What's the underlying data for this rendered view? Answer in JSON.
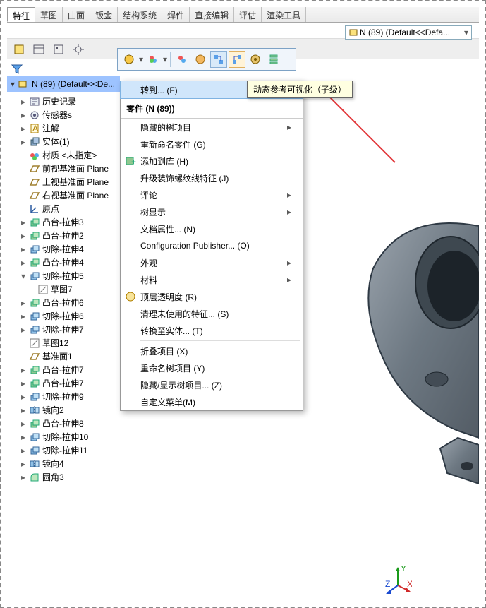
{
  "maintabs": [
    "特征",
    "草图",
    "曲面",
    "钣金",
    "结构系统",
    "焊件",
    "直接编辑",
    "评估",
    "渲染工具"
  ],
  "maintabs_active": 0,
  "config_selector": {
    "label": "N (89)  (Default<<Defa..."
  },
  "tooltip": "动态参考可视化（子级）",
  "tree": {
    "head": "N (89)  (Default<<De...",
    "items": [
      {
        "label": "历史记录",
        "icon": "history",
        "ind": 1,
        "tw": "▸"
      },
      {
        "label": "传感器s",
        "icon": "sensor",
        "ind": 1,
        "tw": "▸"
      },
      {
        "label": "注解",
        "icon": "note",
        "ind": 1,
        "tw": "▸"
      },
      {
        "label": "实体(1)",
        "icon": "solid",
        "ind": 1,
        "tw": "▸"
      },
      {
        "label": "材质 <未指定>",
        "icon": "material",
        "ind": 1,
        "tw": ""
      },
      {
        "label": "前视基准面 Plane",
        "icon": "plane",
        "ind": 1,
        "tw": ""
      },
      {
        "label": "上视基准面 Plane",
        "icon": "plane",
        "ind": 1,
        "tw": ""
      },
      {
        "label": "右视基准面 Plane",
        "icon": "plane",
        "ind": 1,
        "tw": ""
      },
      {
        "label": "原点",
        "icon": "origin",
        "ind": 1,
        "tw": ""
      },
      {
        "label": "凸台-拉伸3",
        "icon": "extrude",
        "ind": 1,
        "tw": "▸"
      },
      {
        "label": "凸台-拉伸2",
        "icon": "extrude",
        "ind": 1,
        "tw": "▸"
      },
      {
        "label": "切除-拉伸4",
        "icon": "cut",
        "ind": 1,
        "tw": "▸"
      },
      {
        "label": "凸台-拉伸4",
        "icon": "extrude",
        "ind": 1,
        "tw": "▸"
      },
      {
        "label": "切除-拉伸5",
        "icon": "cut",
        "ind": 1,
        "tw": "▾"
      },
      {
        "label": "草图7",
        "icon": "sketch",
        "ind": 2,
        "tw": ""
      },
      {
        "label": "凸台-拉伸6",
        "icon": "extrude",
        "ind": 1,
        "tw": "▸"
      },
      {
        "label": "切除-拉伸6",
        "icon": "cut",
        "ind": 1,
        "tw": "▸"
      },
      {
        "label": "切除-拉伸7",
        "icon": "cut",
        "ind": 1,
        "tw": "▸"
      },
      {
        "label": "草图12",
        "icon": "sketch",
        "ind": 1,
        "tw": ""
      },
      {
        "label": "基准面1",
        "icon": "plane",
        "ind": 1,
        "tw": ""
      },
      {
        "label": "凸台-拉伸7",
        "icon": "extrude",
        "ind": 1,
        "tw": "▸"
      },
      {
        "label": "凸台-拉伸7",
        "icon": "extrude",
        "ind": 1,
        "tw": "▸"
      },
      {
        "label": "切除-拉伸9",
        "icon": "cut",
        "ind": 1,
        "tw": "▸"
      },
      {
        "label": "镜向2",
        "icon": "mirror",
        "ind": 1,
        "tw": "▸"
      },
      {
        "label": "凸台-拉伸8",
        "icon": "extrude",
        "ind": 1,
        "tw": "▸"
      },
      {
        "label": "切除-拉伸10",
        "icon": "cut",
        "ind": 1,
        "tw": "▸"
      },
      {
        "label": "切除-拉伸11",
        "icon": "cut",
        "ind": 1,
        "tw": "▸"
      },
      {
        "label": "镜向4",
        "icon": "mirror",
        "ind": 1,
        "tw": "▸"
      },
      {
        "label": "圆角3",
        "icon": "fillet",
        "ind": 1,
        "tw": "▸"
      }
    ]
  },
  "context_menu": {
    "top_row": "转到... (F)",
    "title": "零件 (N (89))",
    "items": [
      {
        "label": "隐藏的树项目",
        "sub": true
      },
      {
        "label": "重新命名零件 (G)"
      },
      {
        "label": "添加到库 (H)",
        "icon": "addlib"
      },
      {
        "label": "升级装饰螺纹线特征 (J)"
      },
      {
        "label": "评论",
        "sub": true
      },
      {
        "label": "树显示",
        "sub": true
      },
      {
        "label": "文档属性... (N)"
      },
      {
        "label": "Configuration Publisher... (O)"
      },
      {
        "label": "外观",
        "sub": true
      },
      {
        "label": "材料",
        "sub": true
      },
      {
        "label": "顶层透明度 (R)",
        "icon": "transp"
      },
      {
        "label": "清理未使用的特征... (S)"
      },
      {
        "label": "转换至实体... (T)"
      },
      {
        "sep": true
      },
      {
        "label": "折叠项目 (X)"
      },
      {
        "label": "重命名树项目 (Y)"
      },
      {
        "label": "隐藏/显示树项目... (Z)"
      },
      {
        "label": "自定义菜单(M)"
      }
    ]
  },
  "axis": {
    "x": "X",
    "y": "Y",
    "z": "Z"
  }
}
